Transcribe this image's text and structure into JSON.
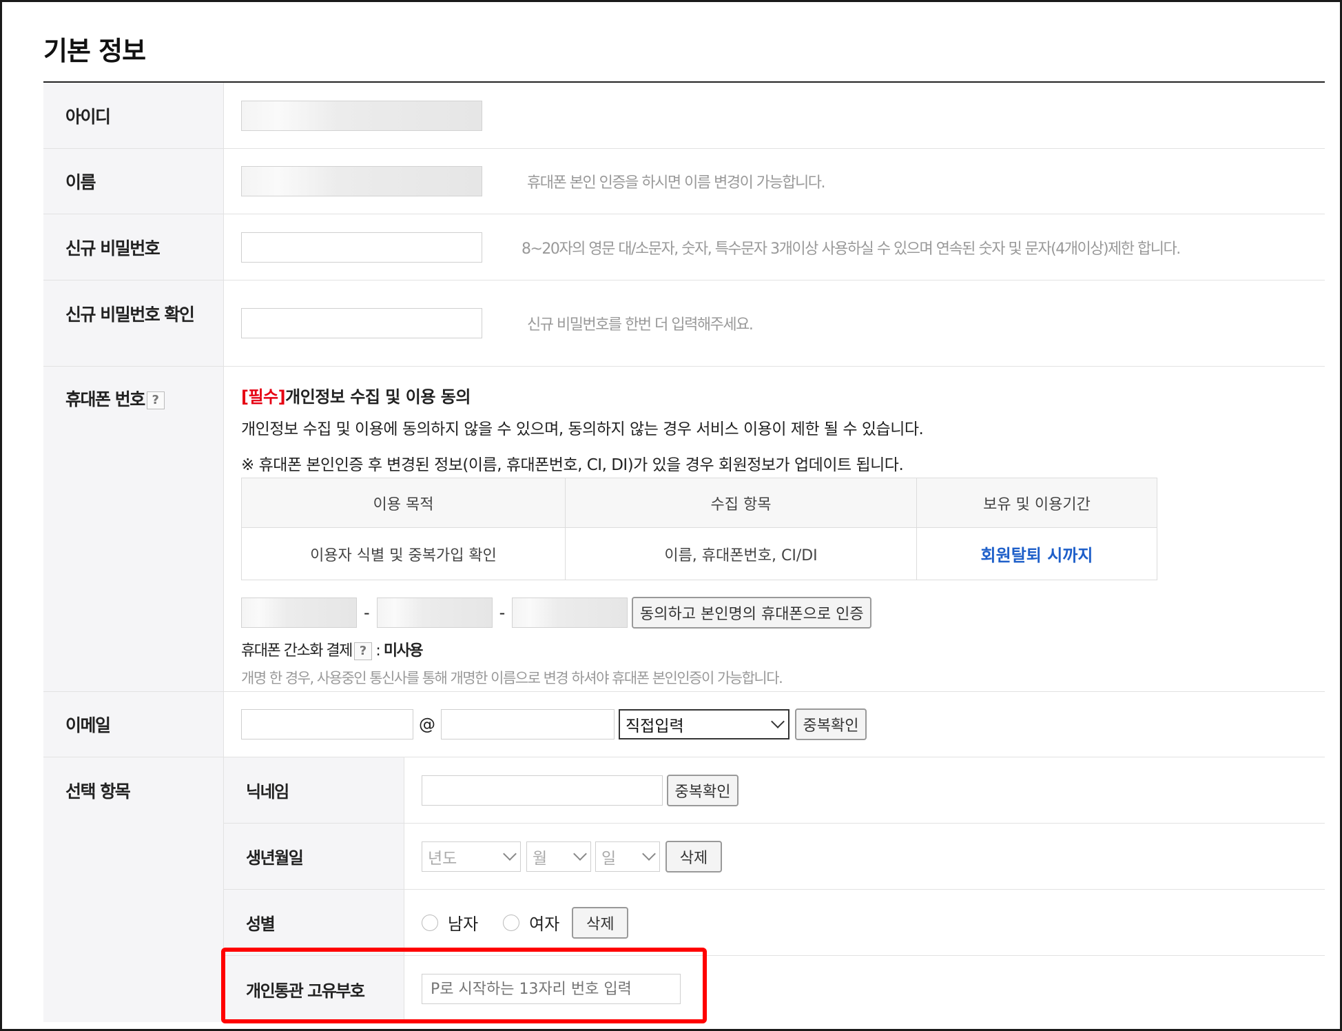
{
  "page_title": "기본 정보",
  "fields": {
    "id": {
      "label": "아이디"
    },
    "name": {
      "label": "이름",
      "hint": "휴대폰 본인 인증을 하시면 이름 변경이 가능합니다."
    },
    "new_password": {
      "label": "신규 비밀번호",
      "hint": "8~20자의 영문 대/소문자, 숫자, 특수문자 3개이상 사용하실 수 있으며 연속된 숫자 및 문자(4개이상)제한 합니다."
    },
    "new_password_confirm": {
      "label": "신규 비밀번호 확인",
      "hint": "신규 비밀번호를 한번 더 입력해주세요."
    },
    "phone": {
      "label": "휴대폰 번호",
      "help_icon": "?",
      "consent_required": "[필수]",
      "consent_title": "개인정보 수집 및 이용 동의",
      "consent_desc": "개인정보 수집 및 이용에 동의하지 않을 수 있으며, 동의하지 않는 경우 서비스 이용이 제한 될 수 있습니다.",
      "consent_note": "※ 휴대폰 본인인증 후 변경된 정보(이름, 휴대폰번호, CI, DI)가 있을 경우 회원정보가 업데이트 됩니다.",
      "table": {
        "headers": [
          "이용 목적",
          "수집 항목",
          "보유 및 이용기간"
        ],
        "row": [
          "이용자 식별 및 중복가입 확인",
          "이름, 휴대폰번호, CI/DI",
          "회원탈퇴 시까지"
        ]
      },
      "dash": "-",
      "verify_button": "동의하고 본인명의 휴대폰으로 인증",
      "easy_pay_label": "휴대폰 간소화 결제",
      "easy_pay_sep": " : ",
      "easy_pay_value": "미사용",
      "rename_hint": "개명 한 경우, 사용중인 통신사를 통해 개명한 이름으로 변경 하셔야 휴대폰 본인인증이 가능합니다."
    },
    "email": {
      "label": "이메일",
      "at": "@",
      "domain_select": "직접입력",
      "check_button": "중복확인"
    },
    "optional": {
      "label": "선택 항목",
      "nickname": {
        "label": "닉네임",
        "check_button": "중복확인"
      },
      "birthday": {
        "label": "생년월일",
        "year": "년도",
        "month": "월",
        "day": "일",
        "delete_button": "삭제"
      },
      "gender": {
        "label": "성별",
        "male": "남자",
        "female": "여자",
        "delete_button": "삭제"
      },
      "customs": {
        "label": "개인통관 고유부호",
        "placeholder": "P로 시작하는 13자리 번호 입력"
      }
    }
  },
  "colors": {
    "required_red": "#e60012",
    "link_blue": "#1e5fc9",
    "highlight_red": "#ff0000"
  }
}
